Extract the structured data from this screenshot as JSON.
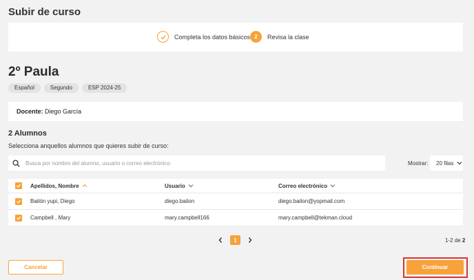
{
  "page": {
    "title": "Subir de curso"
  },
  "stepper": {
    "steps": [
      {
        "label": "Completa los datos básicos",
        "status": "done"
      },
      {
        "number": "2",
        "label": "Revisa la clase",
        "status": "active"
      }
    ]
  },
  "class": {
    "name": "2º Paula",
    "tags": [
      "Español",
      "Segundo",
      "ESP 2024-25"
    ],
    "teacher_label": "Docente:",
    "teacher_name": "Diego García"
  },
  "students": {
    "title": "2 Alumnos",
    "subtitle": "Selecciona anquellos alumnos que quieres subir de curso:",
    "search_placeholder": "Busca por nombre del alumno, usuario o correo electrónico",
    "show_label": "Mostrar:",
    "show_value": "20 filas",
    "columns": [
      "Apellidos, Nombre",
      "Usuario",
      "Correo electrónico"
    ],
    "rows": [
      {
        "name": "Bailón yupi, Diego",
        "user": "diego.bailon",
        "email": "diego.bailon@yopmail.com",
        "checked": true
      },
      {
        "name": "Campbell , Mary",
        "user": "mary.campbell166",
        "email": "mary.campbell@tekman.cloud",
        "checked": true
      }
    ]
  },
  "pagination": {
    "current_page": "1",
    "range": "1-2 de",
    "total": "2"
  },
  "actions": {
    "cancel": "Cancelar",
    "continue": "Continuar"
  },
  "colors": {
    "accent": "#f7a23a",
    "highlight": "#e03030"
  }
}
